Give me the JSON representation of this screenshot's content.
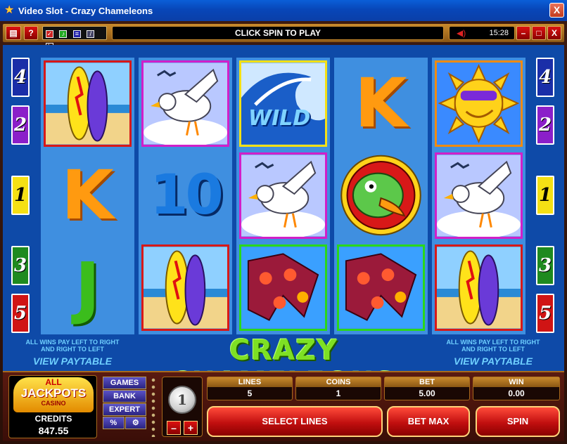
{
  "window": {
    "title": "Video Slot - Crazy Chameleons",
    "close_glyph": "X"
  },
  "toolbar": {
    "message": "CLICK SPIN TO PLAY",
    "time": "15:28",
    "help_label": "?",
    "icon_l": "L",
    "min_glyph": "–",
    "max_glyph": "□",
    "close_glyph": "X"
  },
  "reels": {
    "reel1": [
      "surfboards",
      "K",
      "J"
    ],
    "reel2": [
      "seagull",
      "10",
      "surfboards"
    ],
    "reel3": [
      "wild-wave",
      "seagull",
      "shorts"
    ],
    "reel4": [
      "K",
      "chameleon",
      "shorts"
    ],
    "reel5": [
      "sun",
      "seagull",
      "surfboards"
    ],
    "wild_text": "WILD",
    "k_text": "K",
    "j_text": "J",
    "ten_text": "10"
  },
  "markers": {
    "left": [
      "4",
      "2",
      "1",
      "3",
      "5"
    ],
    "right": [
      "4",
      "2",
      "1",
      "3",
      "5"
    ],
    "colors": {
      "4": "#1a2ea8",
      "2": "#8b1fc9",
      "1": "#f5e014",
      "3": "#1f8a1f",
      "5": "#d01414"
    }
  },
  "paytable": {
    "note_line1": "All wins pay left to right",
    "note_line2": "and right to left",
    "link": "VIEW PAYTABLE"
  },
  "game_title": "CRAZY CHAMELEONS",
  "panel": {
    "logo_top": "ALL",
    "logo_mid": "JACKPOTS",
    "logo_bottom": "CASINO",
    "credits_label": "CREDITS",
    "credits_value": "847.55",
    "menu": {
      "games": "GAMES",
      "bank": "BANK",
      "expert": "EXPERT",
      "percent": "%",
      "gear": "⚙"
    },
    "coin_value": "1",
    "minus": "–",
    "plus": "+",
    "lines_label": "LINES",
    "lines_value": "5",
    "coins_label": "COINS",
    "coins_value": "1",
    "bet_label": "BET",
    "bet_value": "5.00",
    "win_label": "WIN",
    "win_value": "0.00",
    "select_lines": "SELECT LINES",
    "bet_max": "BET MAX",
    "spin": "SPIN"
  }
}
